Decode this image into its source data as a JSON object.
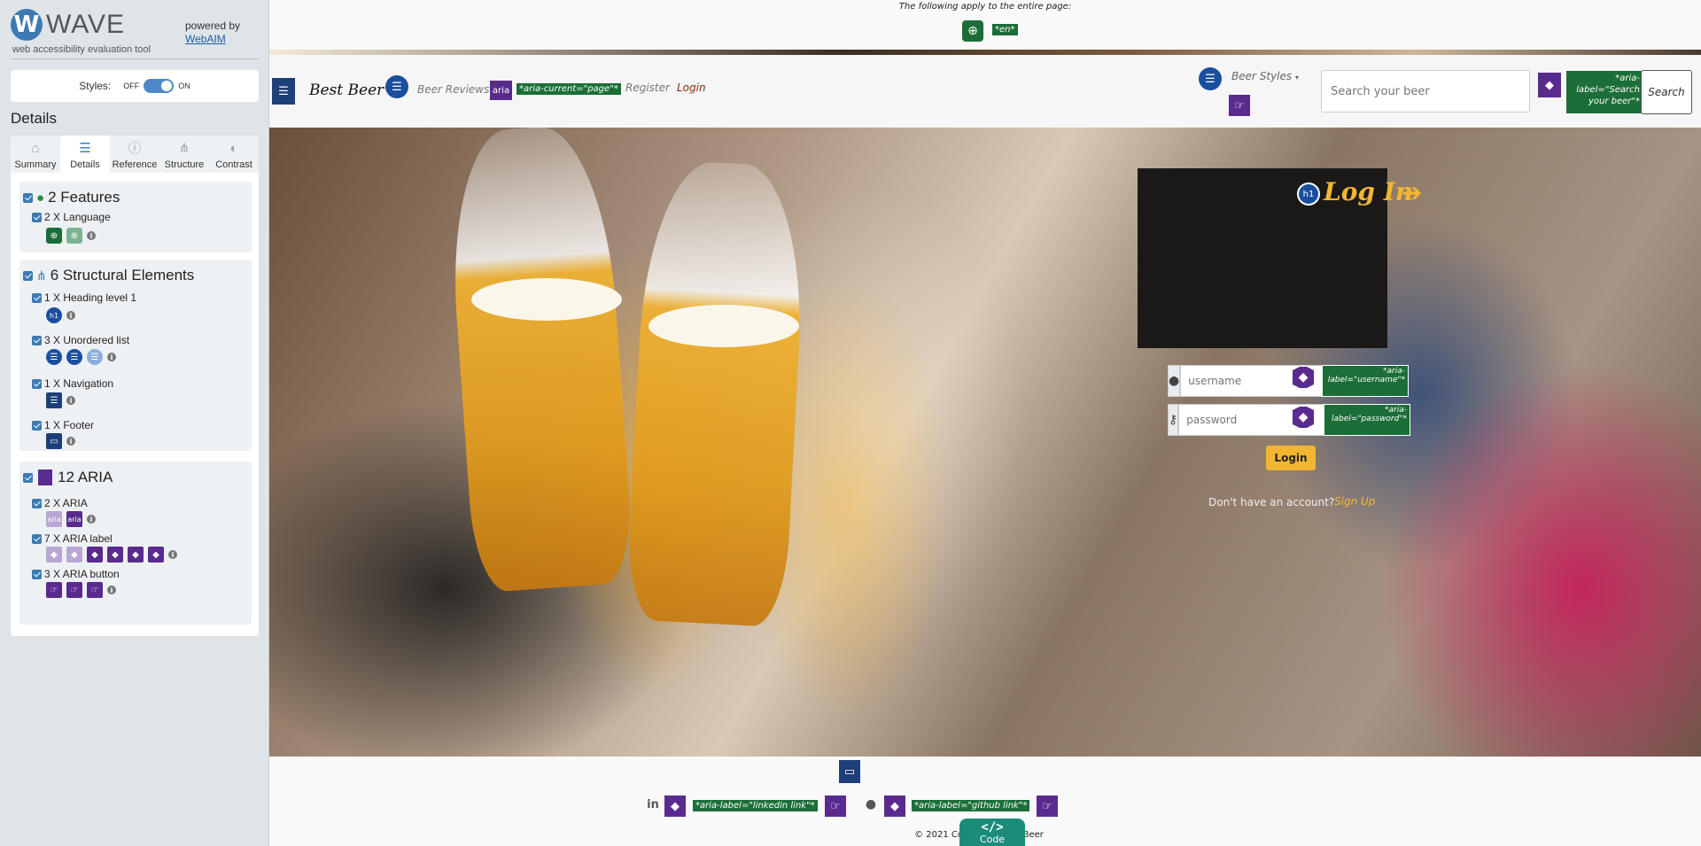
{
  "wave": {
    "logo_letter": "W",
    "logo_word": "WAVE",
    "subtitle": "web accessibility evaluation tool",
    "powered_by": "powered by",
    "webaim": "WebAIM",
    "styles_label": "Styles:",
    "styles_off": "OFF",
    "styles_on": "ON",
    "details_heading": "Details",
    "tabs": [
      {
        "label": "Summary",
        "icon": "home-icon"
      },
      {
        "label": "Details",
        "icon": "list-icon"
      },
      {
        "label": "Reference",
        "icon": "info-icon"
      },
      {
        "label": "Structure",
        "icon": "sitemap-icon"
      },
      {
        "label": "Contrast",
        "icon": "contrast-icon"
      }
    ],
    "features": {
      "heading": "2 Features",
      "items": [
        {
          "label": "2 X Language"
        }
      ]
    },
    "structure": {
      "heading": "6 Structural Elements",
      "items": [
        {
          "label": "1 X Heading level 1"
        },
        {
          "label": "3 X Unordered list"
        },
        {
          "label": "1 X Navigation"
        },
        {
          "label": "1 X Footer"
        }
      ]
    },
    "aria": {
      "heading": "12 ARIA",
      "items": [
        {
          "label": "2 X ARIA"
        },
        {
          "label": "7 X ARIA label"
        },
        {
          "label": "3 X ARIA button"
        }
      ],
      "aria_icon_text": "aria"
    }
  },
  "page": {
    "top_note": "The following apply to the entire page:",
    "lang_tag": "*en*",
    "brand": "Best Beer",
    "nav": {
      "beer_reviews": "Beer Reviews",
      "aria_badge": "aria",
      "aria_current": "*aria-current=\"page\"*",
      "register": "Register",
      "login": "Login",
      "beer_styles": "Beer Styles",
      "search_placeholder": "Search your beer",
      "search_aria_tag": "*aria-label=\"Search your beer\"*",
      "search_button": "Search"
    },
    "login": {
      "h1_badge": "h1",
      "title": "Log In",
      "username_placeholder": "username",
      "username_tag": "*aria-label=\"username\"*",
      "password_placeholder": "password",
      "password_tag": "*aria-label=\"password\"*",
      "button": "Login",
      "no_account": "Don't have an account?",
      "sign_up": "Sign Up"
    },
    "footer": {
      "linkedin_tag": "*aria-label=\"linkedin link\"*",
      "github_tag": "*aria-label=\"github link\"*",
      "copyright": "© 2021 Copyright: Best Beer",
      "code_symbol": "</>",
      "code_label": "Code"
    }
  },
  "colors": {
    "wave_blue": "#3d7ab3",
    "feature_green": "#1b6e37",
    "aria_purple": "#5a2b8e",
    "accent_gold": "#f2b632"
  }
}
